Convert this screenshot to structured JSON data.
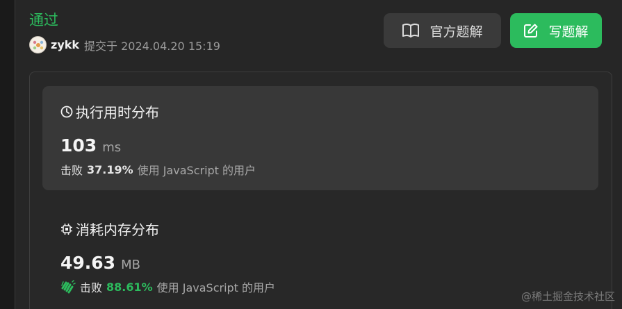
{
  "header": {
    "status": "通过",
    "username": "zykk",
    "submitted_text": "提交于 2024.04.20 15:19"
  },
  "buttons": {
    "solution_label": "官方题解",
    "write_label": "写题解"
  },
  "runtime": {
    "title": "执行用时分布",
    "value": "103",
    "unit": "ms",
    "beat_label": "击败",
    "beat_percent": "37.19%",
    "beat_suffix": "使用 JavaScript 的用户"
  },
  "memory": {
    "title": "消耗内存分布",
    "value": "49.63",
    "unit": "MB",
    "beat_label": "击败",
    "beat_percent": "88.61%",
    "beat_suffix": "使用 JavaScript 的用户"
  },
  "watermark": "@稀土掘金技术社区",
  "colors": {
    "accent_green": "#2cbb5d",
    "background": "#262626",
    "card": "#383838"
  },
  "icons": {
    "solution": "book-icon",
    "write": "edit-icon",
    "runtime": "clock-icon",
    "memory": "chip-icon",
    "beat": "clap-icon"
  }
}
